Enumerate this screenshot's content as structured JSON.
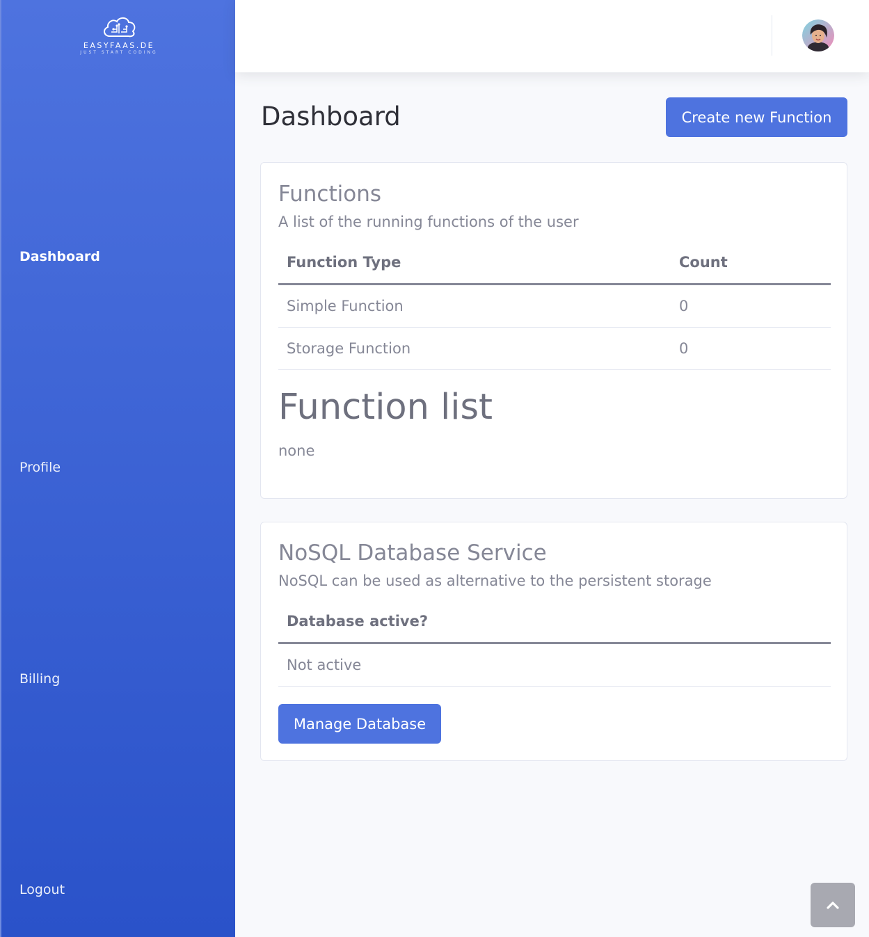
{
  "brand": {
    "name": "EASYFAAS.DE",
    "tagline": "JUST START CODING",
    "logo_icon": "cloud-circuit-icon"
  },
  "sidebar": {
    "items": [
      {
        "label": "Dashboard",
        "active": true
      },
      {
        "label": "Profile",
        "active": false
      },
      {
        "label": "Billing",
        "active": false
      },
      {
        "label": "Logout",
        "active": false
      }
    ]
  },
  "topbar": {
    "avatar_icon": "user-avatar-icon"
  },
  "page": {
    "title": "Dashboard",
    "create_button": "Create new Function"
  },
  "functions_card": {
    "title": "Functions",
    "subtitle": "A list of the running functions of the user",
    "headers": {
      "type": "Function Type",
      "count": "Count"
    },
    "rows": [
      {
        "type": "Simple Function",
        "count": "0"
      },
      {
        "type": "Storage Function",
        "count": "0"
      }
    ],
    "list_title": "Function list",
    "list_empty": "none"
  },
  "nosql_card": {
    "title": "NoSQL Database Service",
    "subtitle": "NoSQL can be used as alternative to the persistent storage",
    "header": "Database active?",
    "status": "Not active",
    "button": "Manage Database"
  },
  "scroll_top_icon": "chevron-up-icon",
  "colors": {
    "primary": "#4e73df",
    "sidebar_bottom": "#2a52c9",
    "text_muted": "#858796"
  }
}
